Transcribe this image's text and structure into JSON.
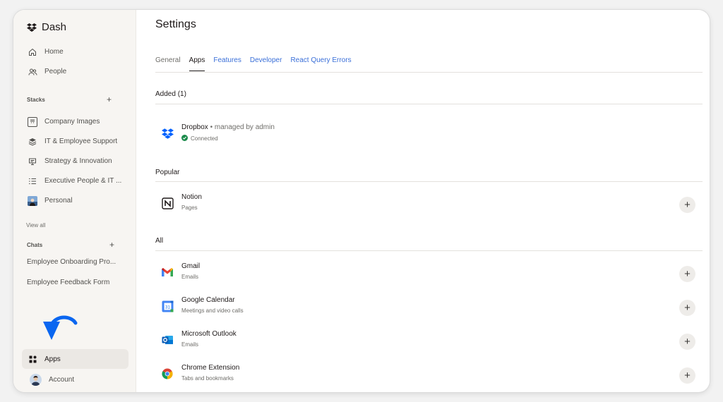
{
  "sidebar": {
    "brand": "Dash",
    "nav": [
      {
        "label": "Home",
        "icon": "home-icon"
      },
      {
        "label": "People",
        "icon": "people-icon"
      }
    ],
    "stacks_label": "Stacks",
    "stacks": [
      {
        "label": "Company Images",
        "icon": "stack-image-icon"
      },
      {
        "label": "IT & Employee Support",
        "icon": "layers-icon"
      },
      {
        "label": "Strategy & Innovation",
        "icon": "presentation-icon"
      },
      {
        "label": "Executive People & IT ...",
        "icon": "checklist-icon"
      },
      {
        "label": "Personal",
        "icon": "photo-thumbnail-icon"
      }
    ],
    "view_all": "View all",
    "chats_label": "Chats",
    "chats": [
      "Employee Onboarding Pro...",
      "Employee Feedback Form"
    ],
    "apps_label": "Apps",
    "account_label": "Account"
  },
  "main": {
    "title": "Settings",
    "tabs": [
      {
        "label": "General"
      },
      {
        "label": "Apps"
      },
      {
        "label": "Features"
      },
      {
        "label": "Developer"
      },
      {
        "label": "React Query Errors"
      }
    ],
    "added_header": "Added (1)",
    "added": [
      {
        "name": "Dropbox",
        "meta": " • managed by admin",
        "status": "Connected",
        "icon": "dropbox-icon"
      }
    ],
    "popular_header": "Popular",
    "popular": [
      {
        "name": "Notion",
        "desc": "Pages",
        "icon": "notion-icon"
      }
    ],
    "all_header": "All",
    "all": [
      {
        "name": "Gmail",
        "desc": "Emails",
        "icon": "gmail-icon"
      },
      {
        "name": "Google Calendar",
        "desc": "Meetings and video calls",
        "icon": "google-calendar-icon"
      },
      {
        "name": "Microsoft Outlook",
        "desc": "Emails",
        "icon": "outlook-icon"
      },
      {
        "name": "Chrome Extension",
        "desc": "Tabs and bookmarks",
        "icon": "chrome-icon"
      }
    ],
    "add_symbol": "+"
  },
  "colors": {
    "link": "#3a6fd8",
    "dropbox": "#0061fe",
    "connected": "#1a8a4a",
    "sidebar_bg": "#f7f5f2"
  }
}
